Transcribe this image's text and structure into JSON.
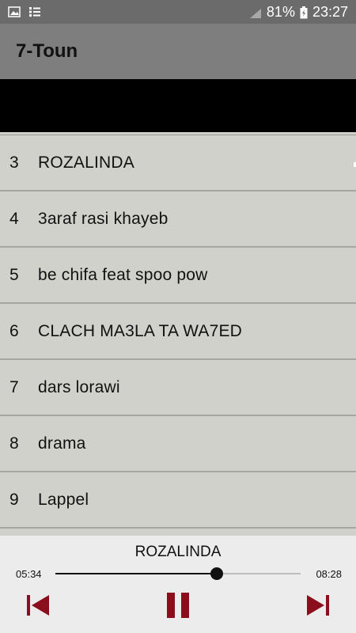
{
  "status_bar": {
    "battery": "81%",
    "time": "23:27",
    "icons": [
      "image-icon",
      "list-icon",
      "signal-icon",
      "battery-icon"
    ]
  },
  "app_bar": {
    "title": "7-Toun"
  },
  "tracks": [
    {
      "num": "3",
      "title": "ROZALINDA"
    },
    {
      "num": "4",
      "title": "3araf rasi khayeb"
    },
    {
      "num": "5",
      "title": "be chifa feat spoo pow"
    },
    {
      "num": "6",
      "title": "CLACH MA3LA TA WA7ED"
    },
    {
      "num": "7",
      "title": "dars lorawi"
    },
    {
      "num": "8",
      "title": "drama"
    },
    {
      "num": "9",
      "title": "Lappel"
    }
  ],
  "player": {
    "now_playing": "ROZALINDA",
    "elapsed": "05:34",
    "total": "08:28",
    "progress": 0.657,
    "controls": [
      "previous-icon",
      "pause-icon",
      "next-icon"
    ]
  },
  "colors": {
    "accent": "#8b0e1d",
    "status_bar": "#6b6b6b",
    "app_bar": "#7e7e7e",
    "list_bg": "#d1d1cc",
    "player_bg": "#ececec"
  }
}
